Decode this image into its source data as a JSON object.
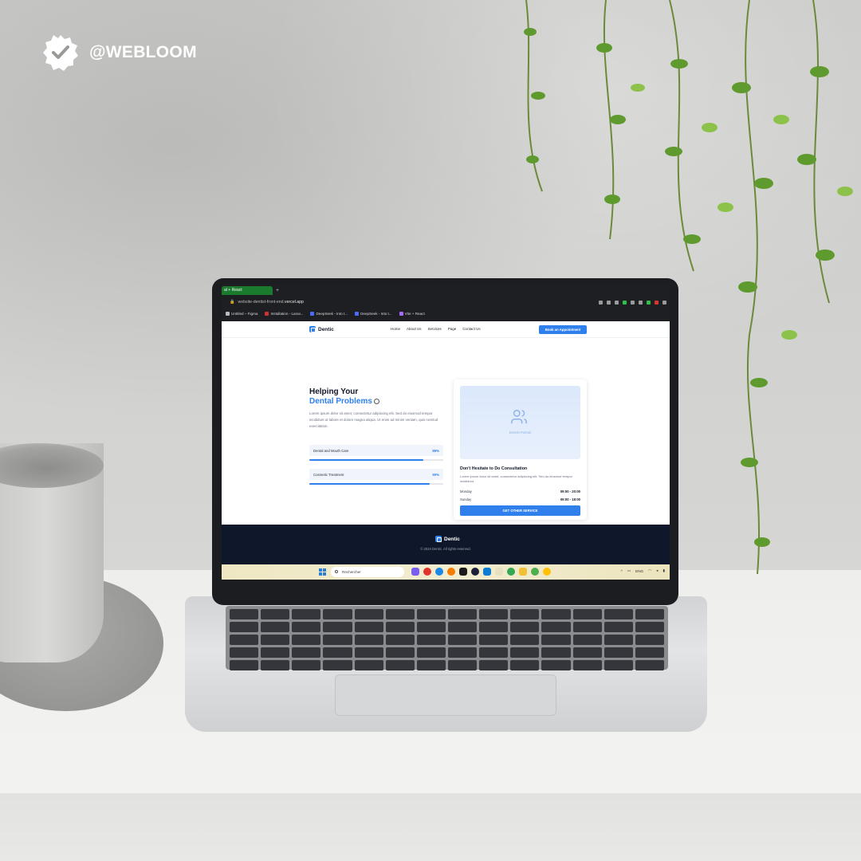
{
  "brand": {
    "handle": "@WEBLOOM"
  },
  "browser": {
    "active_tab": "al + React",
    "new_tab": "+",
    "url_prefix": "website-dentist-front-end.",
    "url_domain": "vercel.app",
    "bookmarks": [
      "Untitled – Figma",
      "Installation - Larav...",
      "DeepSeek - Into t...",
      "DeepSeek - Into t...",
      "Vite + React"
    ]
  },
  "site": {
    "logo": "Dentic",
    "nav": [
      "Home",
      "About Us",
      "Services",
      "Page",
      "Contact Us"
    ],
    "cta": "Book an Appointment",
    "hero": {
      "title_line1": "Helping Your",
      "title_line2": "Dental Problems",
      "description": "Lorem ipsum dolor sit amet, consectetur adipiscing elit. Sed do eiusmod tempor incididunt ut labore et dolore magna aliqua. Ut enim ad minim veniam, quis nostrud exercitation.",
      "skills": [
        {
          "label": "Dental and Mouth Care",
          "percent_label": "85%",
          "percent": 85
        },
        {
          "label": "Cosmetic Treatment",
          "percent_label": "90%",
          "percent": 90
        }
      ]
    },
    "card": {
      "photo_caption": "Dentist Portrait",
      "title": "Don't Hesitate to Do Consultation",
      "description": "Lorem ipsum dolor sit amet, consectetur adipiscing elit. Sed do eiusmod tempor incididunt.",
      "hours": [
        {
          "day": "Monday",
          "time": "09:00 - 20:00"
        },
        {
          "day": "Sunday",
          "time": "09:00 - 18:00"
        }
      ],
      "button": "GET OTHER SERVICE"
    },
    "footer": {
      "logo": "Dentic",
      "copyright": "© 2024 Dentic. All rights reserved."
    }
  },
  "taskbar": {
    "search_placeholder": "Rechercher",
    "language": "ENG"
  },
  "colors": {
    "accent": "#2f80ed",
    "footer": "#0f172a",
    "tab_active": "#1a7a2e"
  }
}
